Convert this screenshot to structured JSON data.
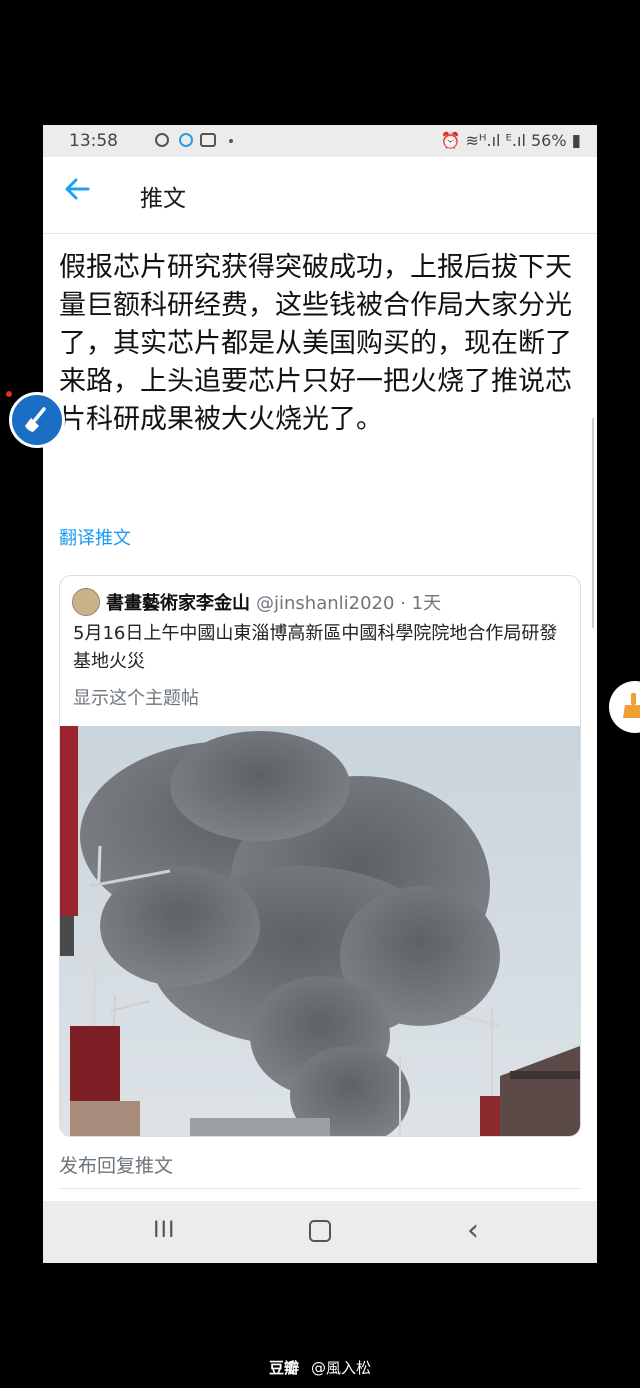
{
  "status_bar": {
    "time": "13:58",
    "right_status": "⏰ ≋ᴴ.ıl ᴱ.ıl 56%",
    "battery_icon": "▮"
  },
  "header": {
    "title": "推文"
  },
  "tweet": {
    "text": "假报芯片研究获得突破成功，上报后拔下天量巨额科研经费，这些钱被合作局大家分光了，其实芯片都是从美国购买的，现在断了来路，上头追要芯片只好一把火烧了推说芯片科研成果被大火烧光了。",
    "translate_label": "翻译推文"
  },
  "quoted_tweet": {
    "name": "書畫藝術家李金山",
    "handle": "@jinshanli2020 · 1天",
    "text": "5月16日上午中國山東淄博高新區中國科學院院地合作局研發基地火災",
    "show_thread_label": "显示这个主题帖"
  },
  "reply_prompt": "发布回复推文",
  "nav_bar": {
    "recent": "III",
    "back": "‹"
  },
  "watermark": {
    "site": "豆瓣",
    "user": "@風入松"
  },
  "icons": [
    "back-arrow-icon",
    "alarm-icon",
    "wifi-icon",
    "signal-icon",
    "battery-icon",
    "broom-icon"
  ],
  "colors": {
    "accent": "#1da1f2",
    "float_button": "#1a6fc5",
    "float_right": "#f0a030"
  }
}
